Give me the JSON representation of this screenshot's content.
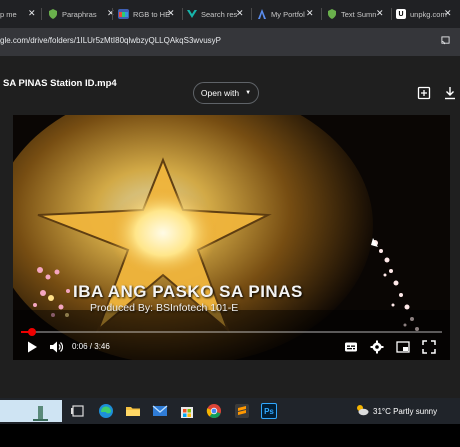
{
  "browser": {
    "tabs": [
      {
        "label": "p me",
        "icon": "generic-tab-icon",
        "color": "#888888"
      },
      {
        "label": "Paraphras",
        "icon": "shield-icon",
        "color": "#6ab04c"
      },
      {
        "label": "RGB to HE",
        "icon": "rgb-icon",
        "color": "#3f5fb3"
      },
      {
        "label": "Search res",
        "icon": "v-icon",
        "color": "#17b4aa"
      },
      {
        "label": "My Portfol",
        "icon": "a-icon",
        "color": "#5b8def"
      },
      {
        "label": "Text Sumn",
        "icon": "shield-icon",
        "color": "#6ab04c"
      },
      {
        "label": "unpkg.com",
        "icon": "u-icon",
        "color": "#ffffff"
      }
    ],
    "url": "gle.com/drive/folders/1ILUr5zMtI80qlwbzyQLLQAkqS3wvusyP"
  },
  "viewer": {
    "file_title": "SA PINAS Station ID.mp4",
    "open_with_label": "Open with",
    "colors": {
      "accent": "#e00000"
    }
  },
  "video": {
    "overlay_title": "IBA ANG PASKO SA PINAS",
    "overlay_subtitle": "Produced By: BSInfotech 101-E",
    "time_display": "0:06 / 3:46",
    "progress_fraction": 0.027
  },
  "taskbar": {
    "weather": "31°C  Partly sunny",
    "apps": [
      "widget-icon",
      "task-view-icon",
      "edge-icon",
      "file-explorer-icon",
      "mail-icon",
      "store-icon",
      "chrome-icon",
      "sublime-icon",
      "photoshop-icon"
    ],
    "photoshop_label": "Ps"
  }
}
